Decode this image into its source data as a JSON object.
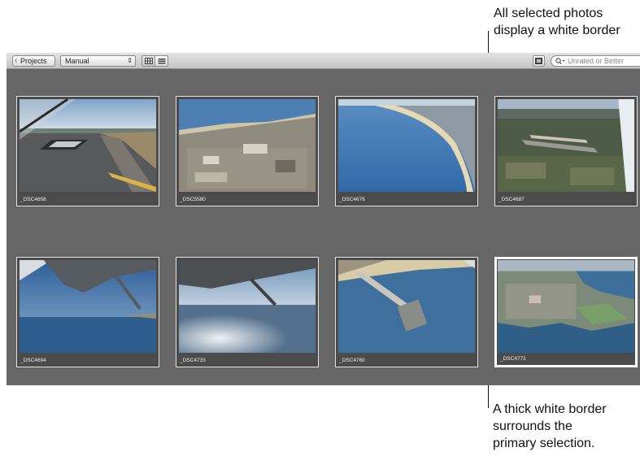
{
  "callouts": {
    "top": [
      "All selected photos",
      "display a white border"
    ],
    "bottom": [
      "A thick white border",
      "surrounds the",
      "primary selection."
    ]
  },
  "toolbar": {
    "projects_label": "Projects",
    "sort_value": "Manual",
    "sort_arrows": "⇕",
    "filter_placeholder": "Unrated or Better",
    "filter_glass": "Q▾",
    "back_chevron": "‹"
  },
  "photos": [
    {
      "name": "_DSC4658",
      "icon": "runway-photo"
    },
    {
      "name": "_DSC5580",
      "icon": "coastal-city-photo"
    },
    {
      "name": "_DSC4676",
      "icon": "beach-coastline-photo"
    },
    {
      "name": "_DSC4687",
      "icon": "airport-aerial-photo"
    },
    {
      "name": "_DSC4694",
      "icon": "wing-sky-photo"
    },
    {
      "name": "_DSC4733",
      "icon": "wing-ocean-glare-photo"
    },
    {
      "name": "_DSC4760",
      "icon": "pier-aerial-photo"
    },
    {
      "name": "_DSC4771",
      "icon": "coastal-town-aerial-photo"
    }
  ],
  "selection": {
    "primary": "_DSC4771"
  },
  "colors": {
    "border": "#ffffff",
    "background": "#666666"
  }
}
